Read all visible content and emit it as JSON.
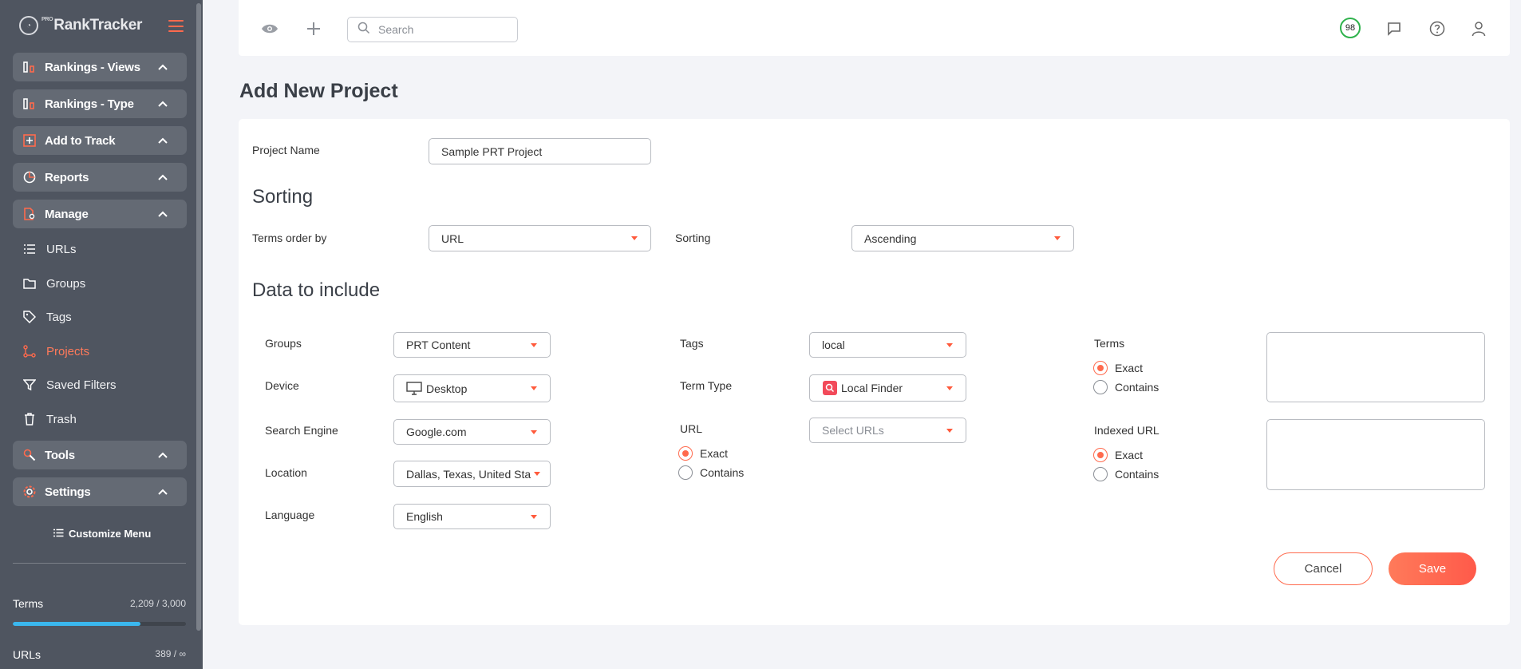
{
  "app": {
    "logo_text": "RankTracker",
    "logo_prefix": "PRO"
  },
  "sidebar": {
    "groups": [
      {
        "label": "Rankings - Views",
        "icon": "bar-chart-icon"
      },
      {
        "label": "Rankings - Type",
        "icon": "bar-chart-icon"
      },
      {
        "label": "Add to Track",
        "icon": "plus-square-icon"
      },
      {
        "label": "Reports",
        "icon": "pie-chart-icon"
      },
      {
        "label": "Manage",
        "icon": "file-gear-icon"
      }
    ],
    "manage_items": [
      {
        "label": "URLs",
        "icon": "list-icon",
        "active": false
      },
      {
        "label": "Groups",
        "icon": "folder-icon",
        "active": false
      },
      {
        "label": "Tags",
        "icon": "tag-icon",
        "active": false
      },
      {
        "label": "Projects",
        "icon": "projects-icon",
        "active": true
      },
      {
        "label": "Saved Filters",
        "icon": "filter-icon",
        "active": false
      },
      {
        "label": "Trash",
        "icon": "trash-icon",
        "active": false
      }
    ],
    "tools_label": "Tools",
    "settings_label": "Settings",
    "customize_label": "Customize Menu",
    "usage": {
      "terms_label": "Terms",
      "terms_value": "2,209 / 3,000",
      "terms_progress": 0.7363,
      "urls_label": "URLs",
      "urls_value": "389 / ∞"
    }
  },
  "topbar": {
    "search_placeholder": "Search",
    "score": "98"
  },
  "page": {
    "title": "Add New Project"
  },
  "form": {
    "project_name_label": "Project Name",
    "project_name_value": "Sample PRT Project",
    "sorting_section": "Sorting",
    "terms_order_label": "Terms order by",
    "terms_order_value": "URL",
    "sorting_label": "Sorting",
    "sorting_value": "Ascending",
    "data_section": "Data to include",
    "groups_label": "Groups",
    "groups_value": "PRT Content",
    "device_label": "Device",
    "device_value": "Desktop",
    "search_engine_label": "Search Engine",
    "search_engine_value": "Google.com",
    "location_label": "Location",
    "location_value": "Dallas, Texas, United States",
    "language_label": "Language",
    "language_value": "English",
    "tags_label": "Tags",
    "tags_value": "local",
    "term_type_label": "Term Type",
    "term_type_value": "Local Finder",
    "url_label": "URL",
    "url_placeholder": "Select URLs",
    "url_exact": "Exact",
    "url_contains": "Contains",
    "terms_label": "Terms",
    "terms_exact": "Exact",
    "terms_contains": "Contains",
    "indexed_url_label": "Indexed URL",
    "indexed_exact": "Exact",
    "indexed_contains": "Contains",
    "cancel_label": "Cancel",
    "save_label": "Save"
  },
  "colors": {
    "accent": "#ff6a4d",
    "sidebar_bg": "#4f5560",
    "progress": "#3ab7ee",
    "score_ring": "#2fb24c"
  }
}
